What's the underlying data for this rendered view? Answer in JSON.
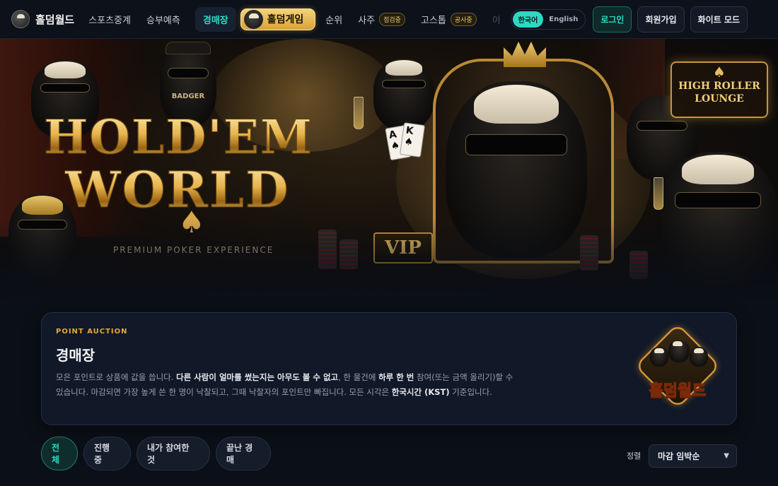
{
  "nav": {
    "brand": "홀덤월드",
    "items": [
      {
        "label": "스포츠중계"
      },
      {
        "label": "승부예측"
      }
    ],
    "active_item": "경매장",
    "holdem_game": "홀덤게임",
    "rank": "순위",
    "saju": "사주",
    "saju_badge": "점검중",
    "gostop": "고스톱",
    "gostop_badge": "공사중",
    "faded_item": "이",
    "lang_ko": "한국어",
    "lang_en": "English",
    "login": "로그인",
    "signup": "회원가입",
    "white_mode": "화이트 모드"
  },
  "hero": {
    "title_line1": "HOLD'EM",
    "title_line2": "WORLD",
    "subtitle": "PREMIUM POKER EXPERIENCE",
    "vip": "VIP",
    "sign_line1": "HIGH ROLLER",
    "sign_line2": "LOUNGE",
    "card1": "A",
    "card2": "K",
    "cap_text": "BADGER"
  },
  "auction": {
    "eyebrow": "POINT AUCTION",
    "title": "경매장",
    "desc_1": "모은 포인트로 상품에 값을 씁니다. ",
    "desc_b1": "다른 사람이 얼마를 썼는지는 아무도 볼 수 없고",
    "desc_2": ", 한 물건에 ",
    "desc_b2": "하루 한 번",
    "desc_3": " 참여(또는 금액 올리기)할 수 있습니다. 마감되면 가장 높게 쓴 한 명이 낙찰되고, 그때 낙찰자의 포인트만 빠집니다. 모든 시각은 ",
    "desc_b3": "한국시간 (KST)",
    "desc_4": " 기준입니다.",
    "emblem_text": "홀덤월드"
  },
  "filters": {
    "tabs": [
      {
        "label": "전체"
      },
      {
        "label": "진행 중"
      },
      {
        "label": "내가 참여한 것"
      },
      {
        "label": "끝난 경매"
      }
    ],
    "sort_label": "정렬",
    "sort_value": "마감 임박순"
  },
  "colors": {
    "accent_teal": "#2ed8c3",
    "gold": "#e3a93b",
    "bg": "#0b0f17"
  }
}
